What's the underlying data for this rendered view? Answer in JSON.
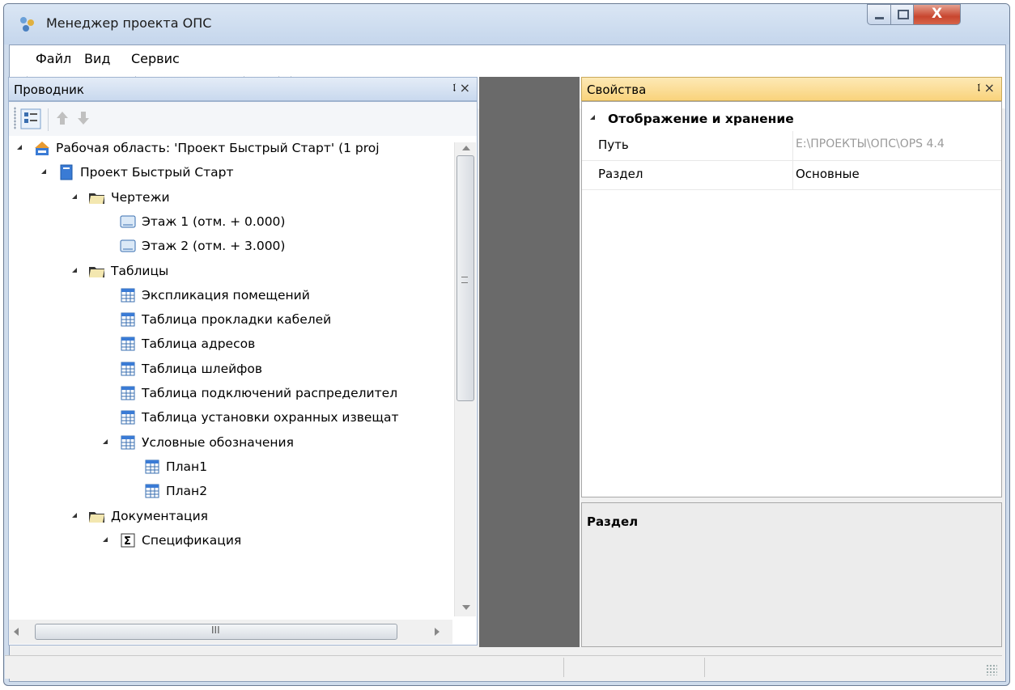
{
  "window": {
    "title": "Менеджер проекта ОПС"
  },
  "menu": [
    "Файл",
    "Вид",
    "Сервис"
  ],
  "explorer": {
    "title": "Проводник",
    "pin_glyph": "ᵖ",
    "close_glyph": "×",
    "tree": [
      {
        "label": "Рабочая область: 'Проект Быстрый Старт' (1 proj",
        "icon": "workspace-icon",
        "level": 0,
        "expanded": true
      },
      {
        "label": "Проект Быстрый Старт",
        "icon": "project-icon",
        "level": 1,
        "expanded": true
      },
      {
        "label": "Чертежи",
        "icon": "folder-icon",
        "level": 2,
        "expanded": true
      },
      {
        "label": "Этаж 1 (отм. + 0.000)",
        "icon": "drawing-icon",
        "level": 3
      },
      {
        "label": "Этаж 2 (отм. + 3.000)",
        "icon": "drawing-icon",
        "level": 3
      },
      {
        "label": "Таблицы",
        "icon": "folder-icon",
        "level": 2,
        "expanded": true
      },
      {
        "label": "Экспликация помещений",
        "icon": "table-icon",
        "level": 3
      },
      {
        "label": "Таблица прокладки кабелей",
        "icon": "table-icon",
        "level": 3
      },
      {
        "label": "Таблица адресов",
        "icon": "table-icon",
        "level": 3
      },
      {
        "label": "Таблица шлейфов",
        "icon": "table-icon",
        "level": 3
      },
      {
        "label": "Таблица подключений распределител",
        "icon": "table-icon",
        "level": 3
      },
      {
        "label": "Таблица установки охранных извещат",
        "icon": "table-icon",
        "level": 3
      },
      {
        "label": "Условные обозначения",
        "icon": "table-icon",
        "level": 3,
        "expanded": true
      },
      {
        "label": "План1",
        "icon": "table-icon",
        "level": 4
      },
      {
        "label": "План2",
        "icon": "table-icon",
        "level": 4
      },
      {
        "label": "Документация",
        "icon": "folder-icon",
        "level": 2,
        "expanded": true
      },
      {
        "label": "Спецификация",
        "icon": "sigma-icon",
        "level": 3,
        "expanded": true
      }
    ],
    "hscroll_glyph": "III"
  },
  "properties": {
    "title": "Свойства",
    "category": "Отображение и хранение",
    "rows": [
      {
        "name": "Путь",
        "value": "E:\\ПРОЕКТЫ\\ОПС\\OPS 4.4"
      },
      {
        "name": "Раздел",
        "value": "Основные"
      }
    ],
    "description_title": "Раздел"
  },
  "colors": {
    "explorer_header": "#c9d9ee",
    "properties_header": "#f9d37c",
    "center_gap": "#6a6a6a",
    "close_button": "#c8462f"
  }
}
